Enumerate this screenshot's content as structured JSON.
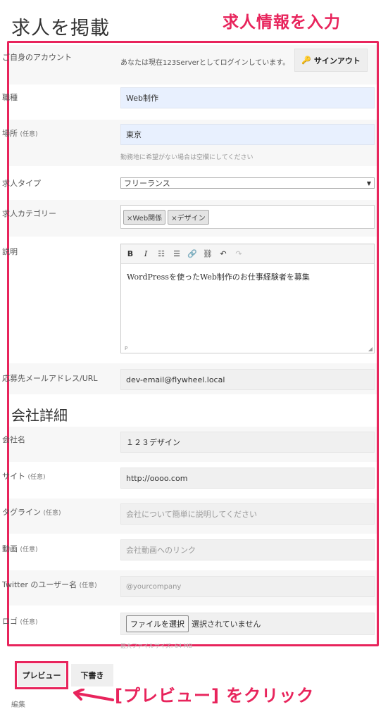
{
  "page": {
    "title": "求人を掲載",
    "callout_top": "求人情報を入力",
    "callout_bottom": "[プレビュー] をクリック",
    "accent_color": "#e8245c"
  },
  "account": {
    "label": "ご自身のアカウント",
    "status_text": "あなたは現在123Serverとしてログインしています。",
    "signout_label": "サインアウト",
    "signout_icon": "key-icon"
  },
  "job": {
    "title_label": "職種",
    "title_value": "Web制作",
    "location_label": "場所",
    "location_optional": "(任意)",
    "location_value": "東京",
    "location_hint": "勤務地に希望がない場合は空欄にしてください",
    "type_label": "求人タイプ",
    "type_value": "フリーランス",
    "category_label": "求人カテゴリー",
    "categories": [
      "×Web関係",
      "×デザイン"
    ],
    "description_label": "説明",
    "description_text": "WordPressを使ったWeb制作のお仕事経験者を募集",
    "editor_status": "P",
    "apply_label": "応募先メールアドレス/URL",
    "apply_value": "dev-email@flywheel.local"
  },
  "editor_toolbar": [
    "B",
    "I",
    "☷",
    "☰",
    "🔗",
    "⛓",
    "↶",
    "↷"
  ],
  "company": {
    "section_title": "会社詳細",
    "name_label": "会社名",
    "name_value": "１２３デザイン",
    "site_label": "サイト",
    "site_optional": "(任意)",
    "site_value": "http://oooo.com",
    "tagline_label": "タグライン",
    "tagline_optional": "(任意)",
    "tagline_placeholder": "会社について簡単に説明してください",
    "video_label": "動画",
    "video_optional": "(任意)",
    "video_placeholder": "会社動画へのリンク",
    "twitter_label": "Twitter のユーザー名",
    "twitter_optional": "(任意)",
    "twitter_placeholder": "@yourcompany",
    "logo_label": "ロゴ",
    "logo_optional": "(任意)",
    "file_button": "ファイルを選択",
    "file_status": "選択されていません",
    "max_size_hint": "最大ファイルサイズ: 64 MB"
  },
  "actions": {
    "preview_label": "プレビュー",
    "draft_label": "下書き",
    "edit_link": "編集"
  }
}
